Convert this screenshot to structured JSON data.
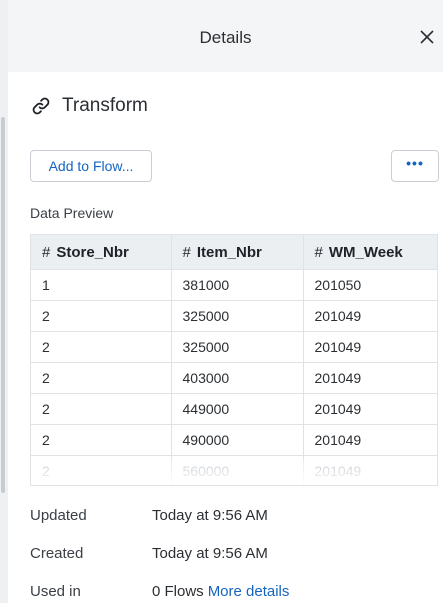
{
  "header": {
    "title": "Details",
    "close_icon": "close-icon"
  },
  "transform": {
    "icon": "link-icon",
    "label": "Transform"
  },
  "actions": {
    "add_to_flow_label": "Add to Flow...",
    "more_label": "•••"
  },
  "preview": {
    "title": "Data Preview",
    "columns": [
      {
        "type_symbol": "#",
        "name": "Store_Nbr"
      },
      {
        "type_symbol": "#",
        "name": "Item_Nbr"
      },
      {
        "type_symbol": "#",
        "name": "WM_Week"
      }
    ],
    "rows": [
      [
        "1",
        "381000",
        "201050"
      ],
      [
        "2",
        "325000",
        "201049"
      ],
      [
        "2",
        "325000",
        "201049"
      ],
      [
        "2",
        "403000",
        "201049"
      ],
      [
        "2",
        "449000",
        "201049"
      ],
      [
        "2",
        "490000",
        "201049"
      ],
      [
        "2",
        "560000",
        "201049"
      ]
    ]
  },
  "meta": {
    "updated_label": "Updated",
    "updated_value": "Today at 9:56 AM",
    "created_label": "Created",
    "created_value": "Today at 9:56 AM",
    "used_in_label": "Used in",
    "used_in_value": "0 Flows",
    "more_details_link": "More details"
  },
  "colors": {
    "accent": "#1565c0",
    "header_bg": "#f4f5f6",
    "table_header_bg": "#eceff1",
    "border": "#dfe3e8"
  }
}
